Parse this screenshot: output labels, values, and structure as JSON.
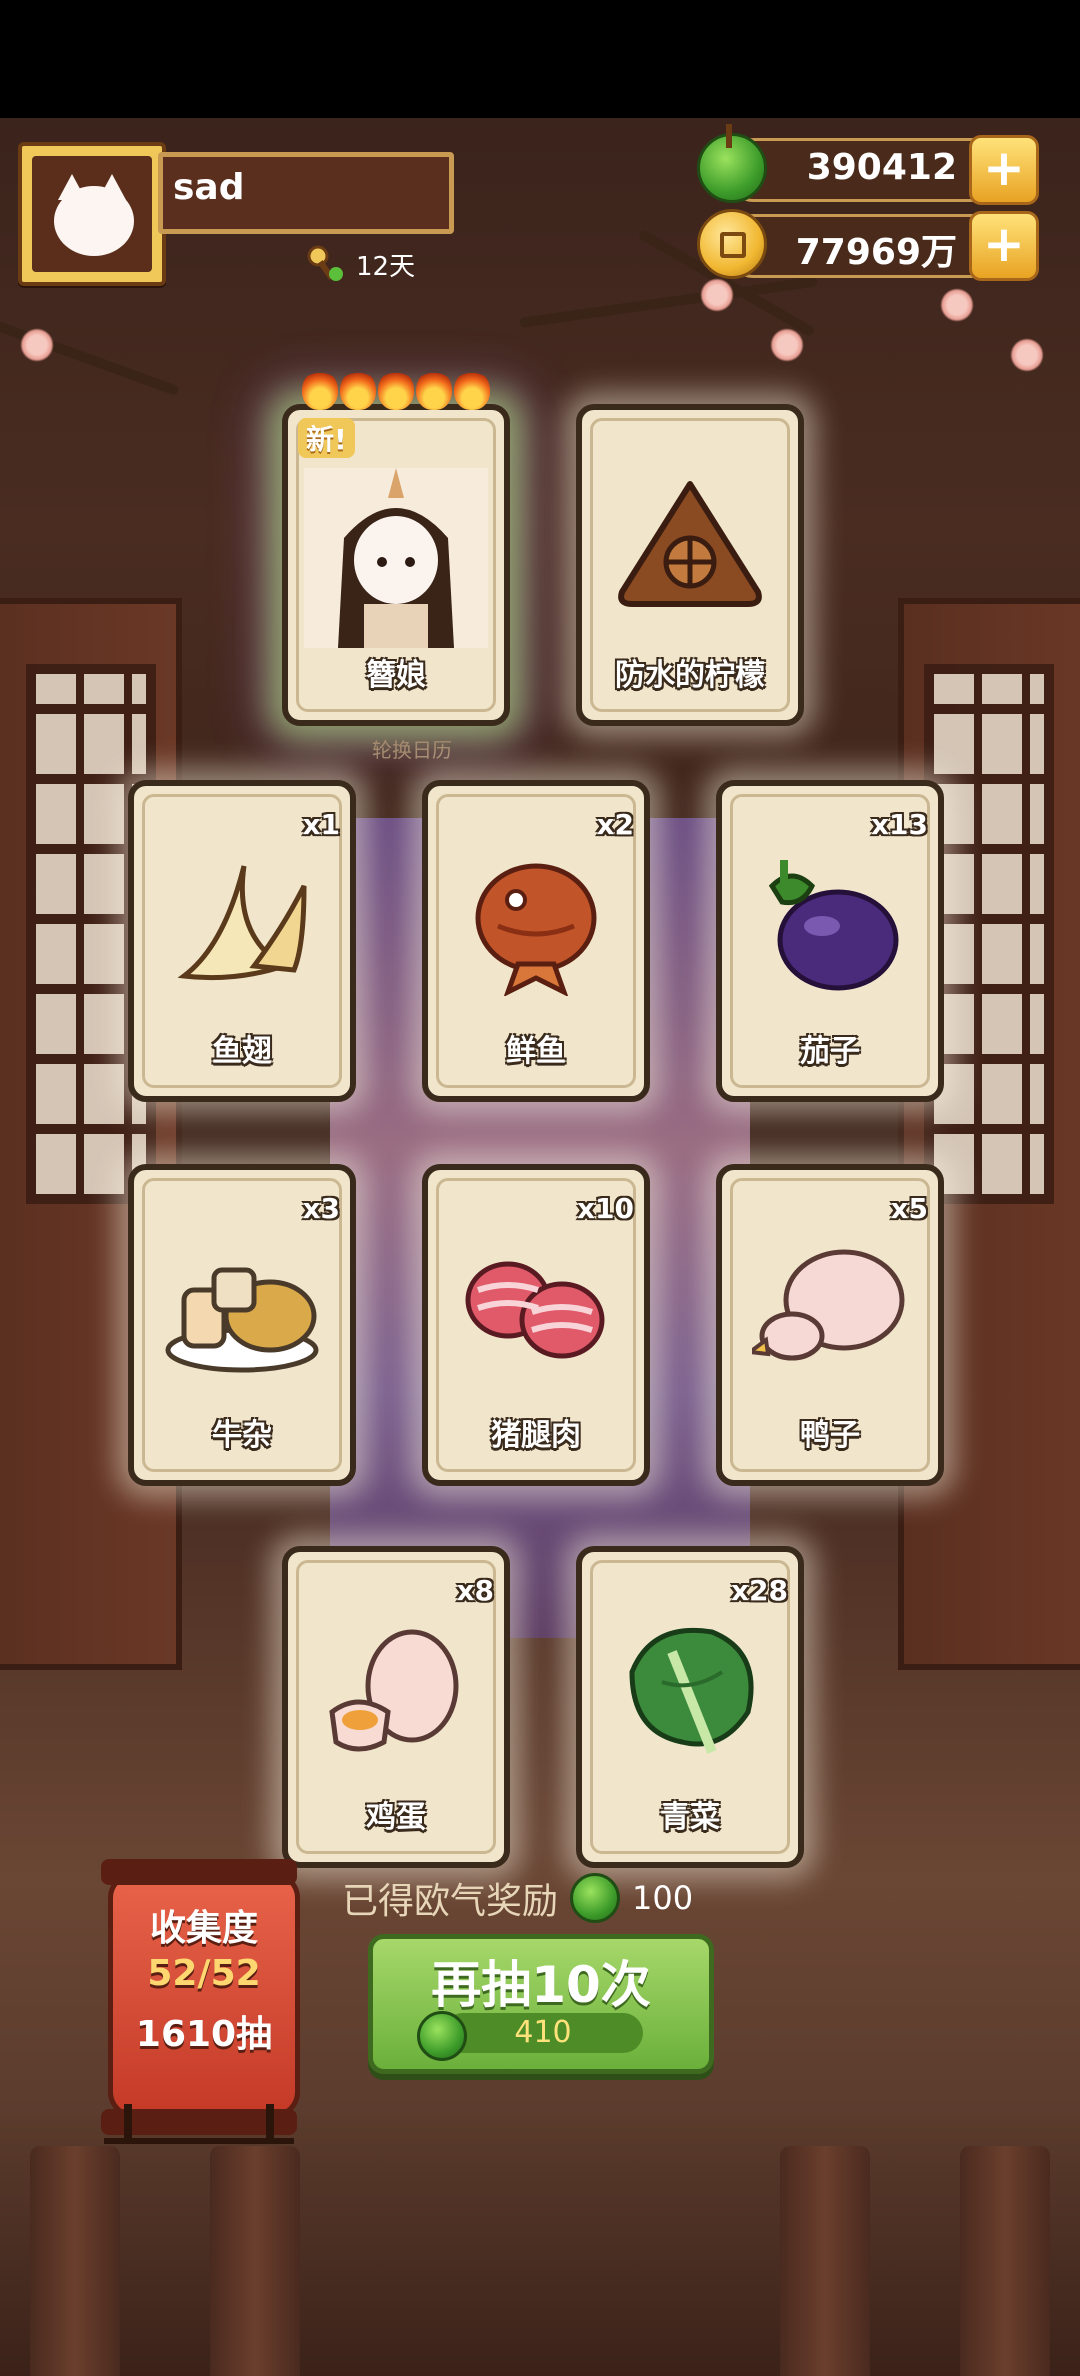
{
  "player": {
    "name": "sad",
    "days": "12天",
    "avatar_icon": "cat-avatar-icon"
  },
  "currencies": {
    "jade": "390412",
    "coins": "77969万"
  },
  "featured_cards": [
    {
      "label": "簪娘",
      "badge": "新!",
      "stars": 5
    },
    {
      "label": "防水的柠檬",
      "badge": "",
      "stars": 0
    }
  ],
  "sub_caption": "轮换日历",
  "cards": [
    {
      "label": "鱼翅",
      "qty": "x1",
      "icon": "shark-fin-icon"
    },
    {
      "label": "鲜鱼",
      "qty": "x2",
      "icon": "fish-icon"
    },
    {
      "label": "茄子",
      "qty": "x13",
      "icon": "eggplant-icon"
    },
    {
      "label": "牛杂",
      "qty": "x3",
      "icon": "beef-offal-icon"
    },
    {
      "label": "猪腿肉",
      "qty": "x10",
      "icon": "pork-leg-icon"
    },
    {
      "label": "鸭子",
      "qty": "x5",
      "icon": "duck-icon"
    },
    {
      "label": "鸡蛋",
      "qty": "x8",
      "icon": "egg-icon"
    },
    {
      "label": "青菜",
      "qty": "x28",
      "icon": "greens-icon"
    }
  ],
  "bonus": {
    "text": "已得欧气奖励",
    "value": "100"
  },
  "redraw": {
    "label": "再抽10次",
    "cost": "410"
  },
  "collection": {
    "title": "收集度",
    "progress": "52/52",
    "draws": "1610抽"
  }
}
